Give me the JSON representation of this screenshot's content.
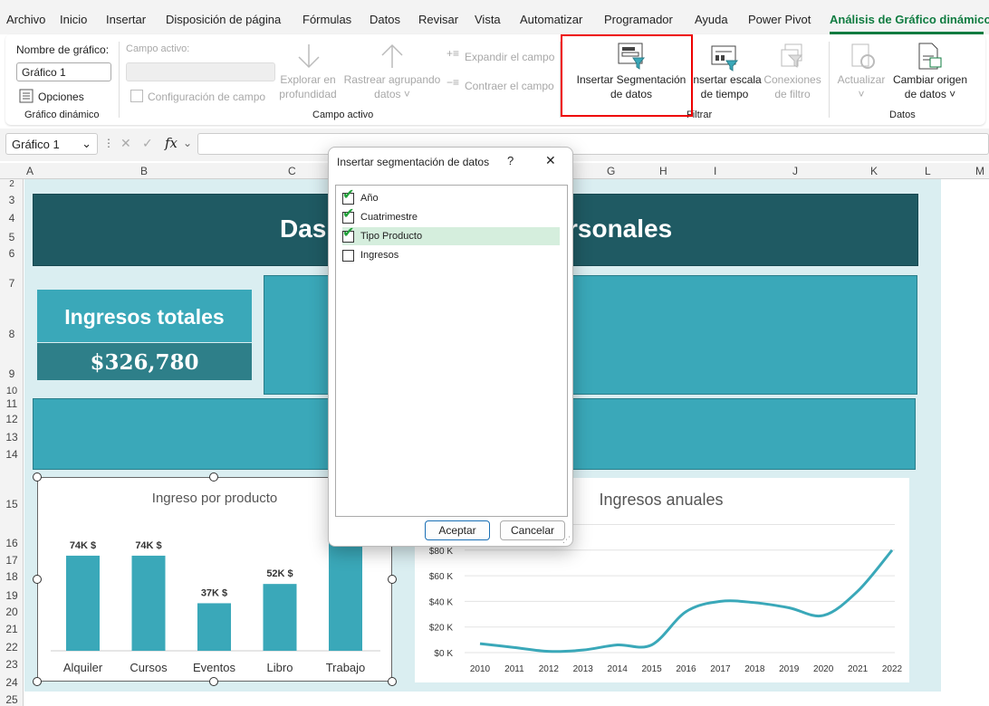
{
  "menu": {
    "items": [
      "Archivo",
      "Inicio",
      "Insertar",
      "Disposición de página",
      "Fórmulas",
      "Datos",
      "Revisar",
      "Vista",
      "Automatizar",
      "Programador",
      "Ayuda",
      "Power Pivot",
      "Análisis de Gráfico dinámico"
    ],
    "active_index": 12
  },
  "ribbon": {
    "chart_name_label": "Nombre de gráfico:",
    "chart_name_value": "Gráfico 1",
    "options_label": "Opciones",
    "group1_label": "Gráfico dinámico",
    "active_field_label": "Campo activo:",
    "field_settings_label": "Configuración de campo",
    "explore_line1": "Explorar en",
    "explore_line2": "profundidad",
    "drill_line1": "Rastrear agrupando",
    "drill_line2": "datos ˅",
    "expand_label": "Expandir el campo",
    "collapse_label": "Contraer el campo",
    "group2_label": "Campo activo",
    "insert_slicer_line1": "Insertar Segmentación",
    "insert_slicer_line2": "de datos",
    "insert_timeline_line1": "Insertar escala",
    "insert_timeline_line2": "de tiempo",
    "filter_conn_line1": "Conexiones",
    "filter_conn_line2": "de filtro",
    "group3_label": "Filtrar",
    "refresh_label": "Actualizar",
    "change_source_line1": "Cambiar origen",
    "change_source_line2": "de datos ˅",
    "group4_label": "Datos"
  },
  "formula_bar": {
    "name_box": "Gráfico 1",
    "fx_label": "fx",
    "value": ""
  },
  "columns": [
    "A",
    "B",
    "C",
    "G",
    "H",
    "I",
    "J",
    "K",
    "L",
    "M"
  ],
  "rows": [
    "2",
    "3",
    "4",
    "5",
    "6",
    "7",
    "8",
    "9",
    "10",
    "11",
    "12",
    "13",
    "14",
    "15",
    "16",
    "17",
    "18",
    "19",
    "20",
    "21",
    "22",
    "23",
    "24",
    "25"
  ],
  "dashboard": {
    "title_left": "Das",
    "title_right": "rsonales",
    "card_title": "Ingresos totales",
    "card_value": "$326,780"
  },
  "bar_chart": {
    "title": "Ingreso por producto",
    "categories": [
      "Alquiler",
      "Cursos",
      "Eventos",
      "Libro",
      "Trabajo"
    ],
    "values": [
      74,
      74,
      37,
      52,
      100
    ],
    "labels": [
      "74K $",
      "74K $",
      "37K $",
      "52K $",
      ""
    ],
    "color": "#3aa8b9"
  },
  "line_chart": {
    "title": "Ingresos anuales",
    "x": [
      "2010",
      "2011",
      "2012",
      "2013",
      "2014",
      "2015",
      "2016",
      "2017",
      "2018",
      "2019",
      "2020",
      "2021",
      "2022"
    ],
    "y": [
      7,
      4,
      1,
      2,
      6,
      6,
      32,
      40,
      39,
      35,
      29,
      48,
      80
    ],
    "y_ticks": [
      "$0 K",
      "$20 K",
      "$40 K",
      "$60 K",
      "$80 K"
    ],
    "ylim": [
      0,
      100
    ],
    "color": "#3aa8b9"
  },
  "dialog": {
    "title": "Insertar segmentación de datos",
    "help": "?",
    "close": "✕",
    "fields": [
      {
        "label": "Año",
        "checked": true
      },
      {
        "label": "Cuatrimestre",
        "checked": true
      },
      {
        "label": "Tipo Producto",
        "checked": true,
        "highlight": true
      },
      {
        "label": "Ingresos",
        "checked": false
      }
    ],
    "ok": "Aceptar",
    "cancel": "Cancelar"
  }
}
